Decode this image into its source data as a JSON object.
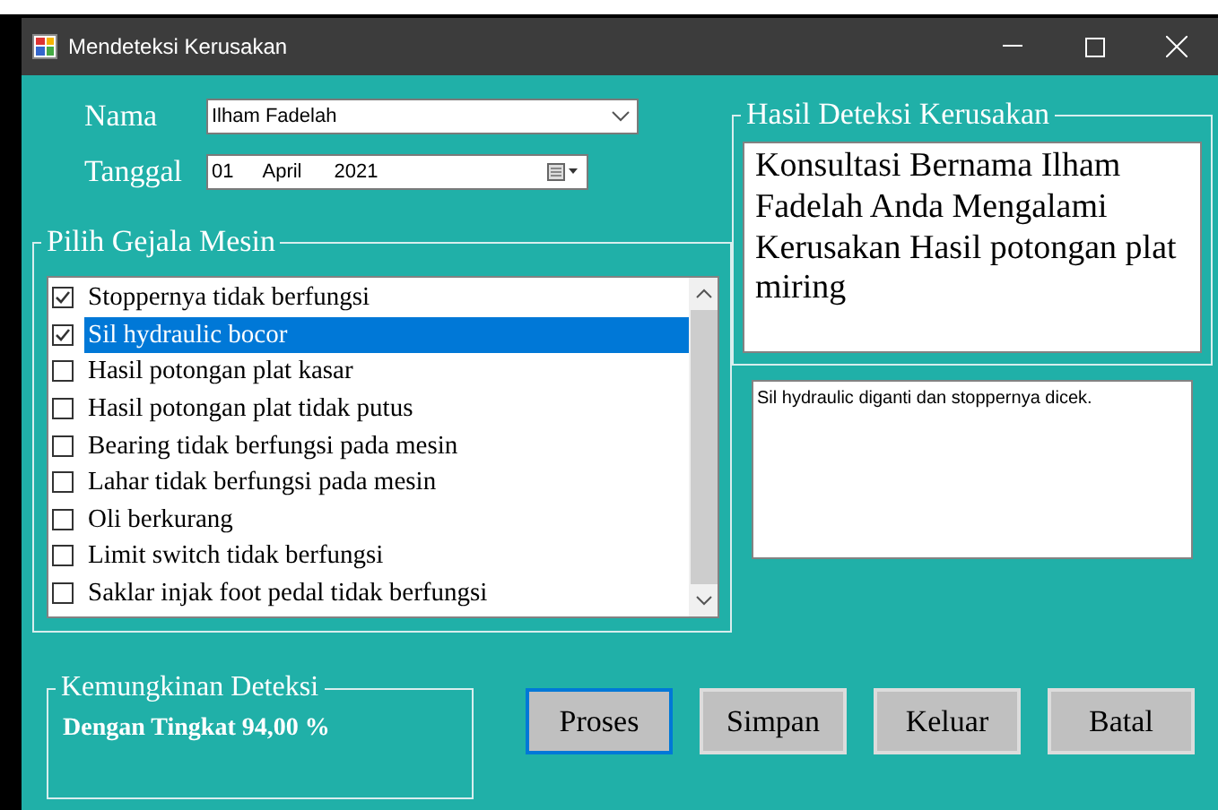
{
  "window": {
    "title": "Mendeteksi Kerusakan"
  },
  "nama": {
    "label": "Nama",
    "value": "Ilham Fadelah"
  },
  "tanggal": {
    "label": "Tanggal",
    "day": "01",
    "month": "April",
    "year": "2021"
  },
  "gejala": {
    "title": "Pilih Gejala Mesin",
    "items": [
      {
        "label": "Stoppernya tidak berfungsi",
        "checked": true,
        "selected": false
      },
      {
        "label": "Sil hydraulic bocor",
        "checked": true,
        "selected": true
      },
      {
        "label": "Hasil potongan plat kasar",
        "checked": false,
        "selected": false
      },
      {
        "label": "Hasil potongan plat tidak putus",
        "checked": false,
        "selected": false
      },
      {
        "label": "Bearing tidak berfungsi pada mesin",
        "checked": false,
        "selected": false
      },
      {
        "label": "Lahar tidak berfungsi pada mesin",
        "checked": false,
        "selected": false
      },
      {
        "label": "Oli berkurang",
        "checked": false,
        "selected": false
      },
      {
        "label": "Limit switch tidak berfungsi",
        "checked": false,
        "selected": false
      },
      {
        "label": "Saklar injak foot pedal tidak berfungsi",
        "checked": false,
        "selected": false
      }
    ]
  },
  "hasil": {
    "title": "Hasil Deteksi Kerusakan",
    "text": " Konsultasi Bernama Ilham Fadelah Anda Mengalami Kerusakan Hasil potongan plat miring"
  },
  "saran": {
    "text": "Sil hydraulic diganti dan stoppernya dicek."
  },
  "kemungkinan": {
    "title": "Kemungkinan Deteksi",
    "text": "Dengan Tingkat 94,00 %"
  },
  "buttons": [
    {
      "label": "Proses",
      "focused": true
    },
    {
      "label": "Simpan",
      "focused": false
    },
    {
      "label": "Keluar",
      "focused": false
    },
    {
      "label": "Batal",
      "focused": false
    }
  ]
}
